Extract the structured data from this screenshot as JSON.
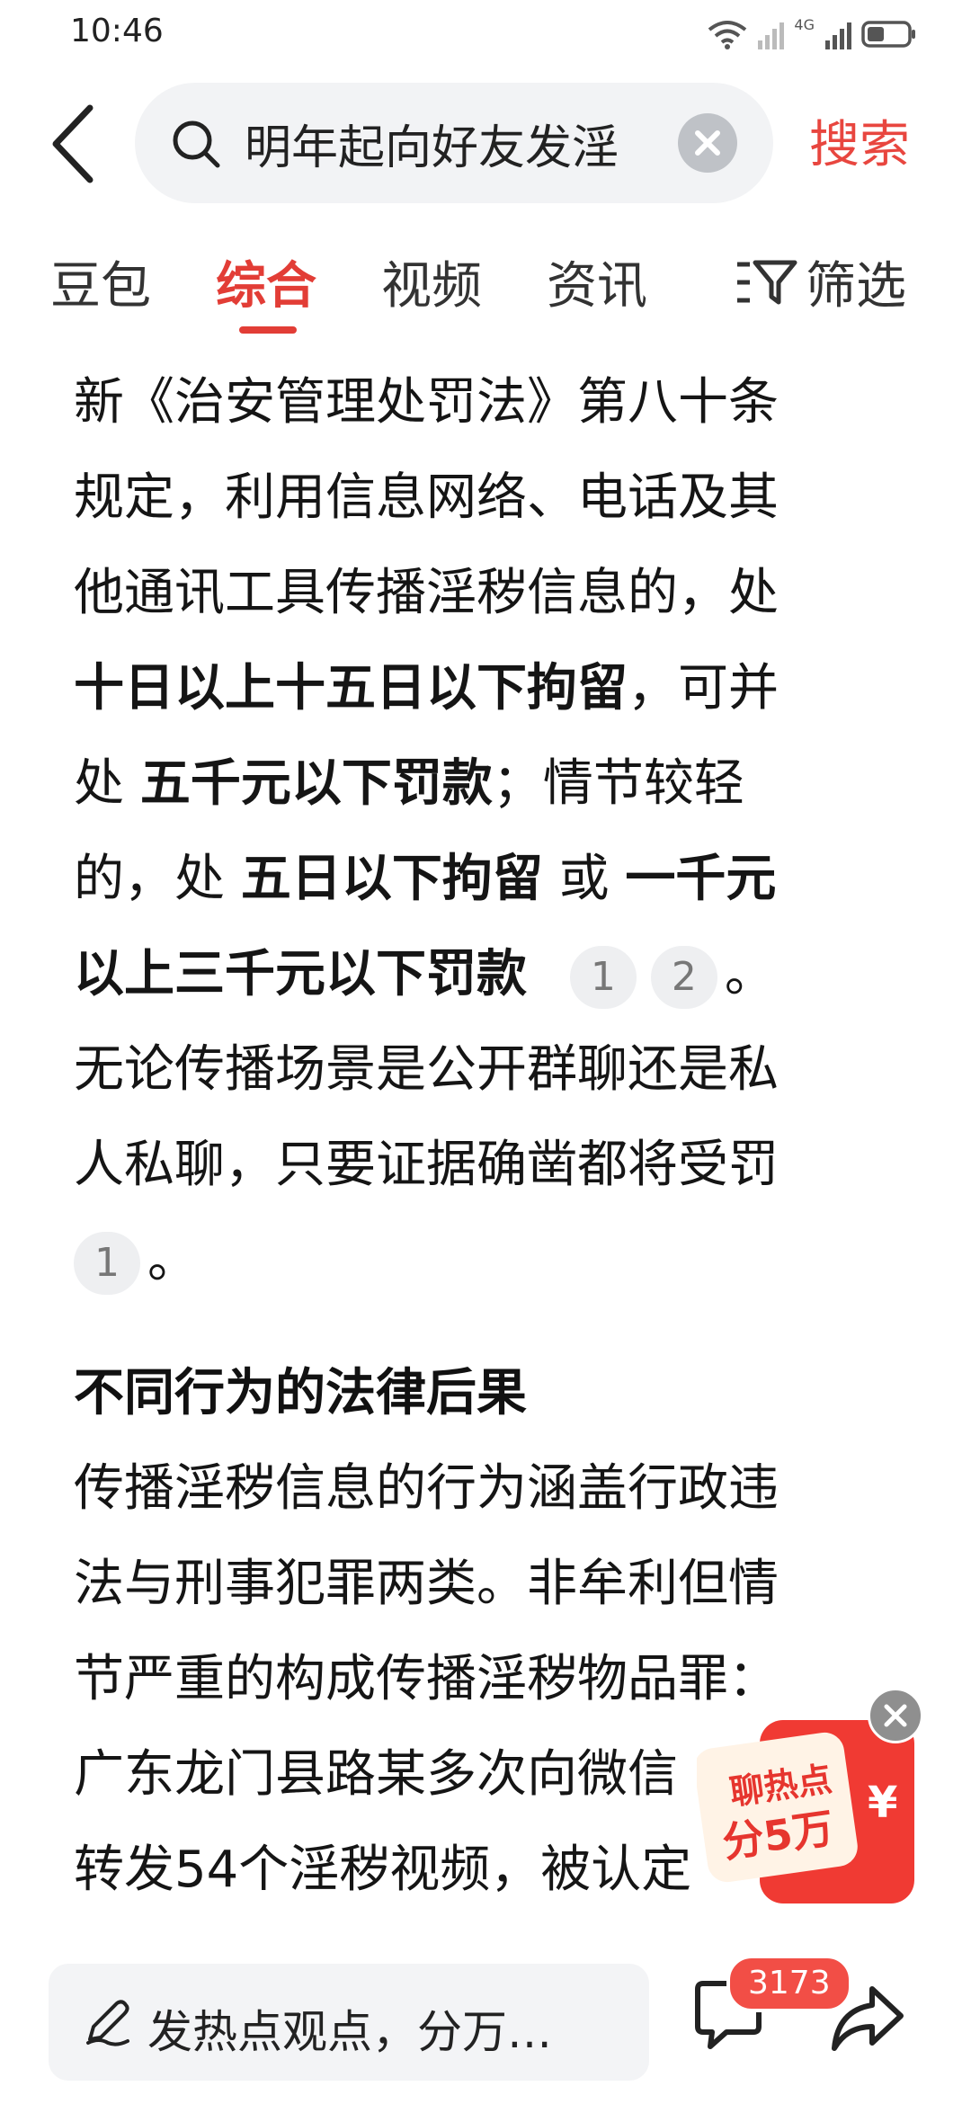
{
  "status_bar": {
    "time": "10:46",
    "network": "4G"
  },
  "search": {
    "query": "明年起向好友发淫",
    "button": "搜索"
  },
  "tabs": [
    {
      "label": "豆包"
    },
    {
      "label": "综合"
    },
    {
      "label": "视频"
    },
    {
      "label": "资讯"
    }
  ],
  "filter_label": "筛选",
  "article": {
    "p1": {
      "l1": "新《治安管理处罚法》第八十条",
      "l2": "规定，利用信息网络、电话及其",
      "l3": "他通讯工具传播淫秽信息的，处",
      "l4_bold": "十日以上十五日以下拘留",
      "l4_rest": "，可并",
      "l5_a": "处 ",
      "l5_bold": "五千元以下罚款",
      "l5_rest": "；情节较轻",
      "l6_a": "的，处 ",
      "l6_bold1": "五日以下拘留",
      "l6_b": " 或 ",
      "l6_bold2": "一千元",
      "l7_bold": "以上三千元以下罚款",
      "cite1": "1",
      "cite2": "2",
      "period": "。",
      "l8": "无论传播场景是公开群聊还是私",
      "l9": "人私聊，只要证据确凿都将受罚",
      "cite3": "1",
      "period2": "。"
    },
    "heading": "不同行为的法律后果",
    "p2": {
      "l1": "传播淫秽信息的行为涵盖行政违",
      "l2": "法与刑事犯罪两类。非牟利但情",
      "l3": "节严重的构成传播淫秽物品罪：",
      "l4": "广东龙门县路某多次向微信",
      "l5": "转发54个淫秽视频，被认定"
    }
  },
  "red_packet": {
    "line1": "聊热点",
    "line2": "分5万",
    "symbol": "¥"
  },
  "bottom_bar": {
    "comment_placeholder": "发热点观点，分万…",
    "comment_count": "3173"
  },
  "colors": {
    "accent": "#e23d36",
    "badge": "#f24e46"
  }
}
